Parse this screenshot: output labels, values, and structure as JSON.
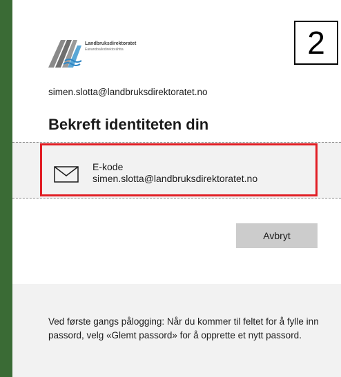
{
  "colors": {
    "outer_background": "#3a6b35",
    "card_background": "#ffffff",
    "highlight_border": "#e11d24",
    "button_background": "#cccccc",
    "panel_background": "#f2f2f2"
  },
  "logo": {
    "name": "Landbruksdirektoratet",
    "subtitle": "Eanandoallodirektoráhtta"
  },
  "step_marker": "2",
  "account": {
    "email": "simen.slotta@landbruksdirektoratet.no"
  },
  "heading": "Bekreft identiteten din",
  "verification_option": {
    "icon": "envelope-icon",
    "type_label": "E-kode",
    "detail": "simen.slotta@landbruksdirektoratet.no"
  },
  "actions": {
    "cancel_label": "Avbryt"
  },
  "info": {
    "text": "Ved første gangs pålogging: Når du kommer til feltet for å fylle inn passord, velg «Glemt passord» for å opprette et nytt passord."
  }
}
